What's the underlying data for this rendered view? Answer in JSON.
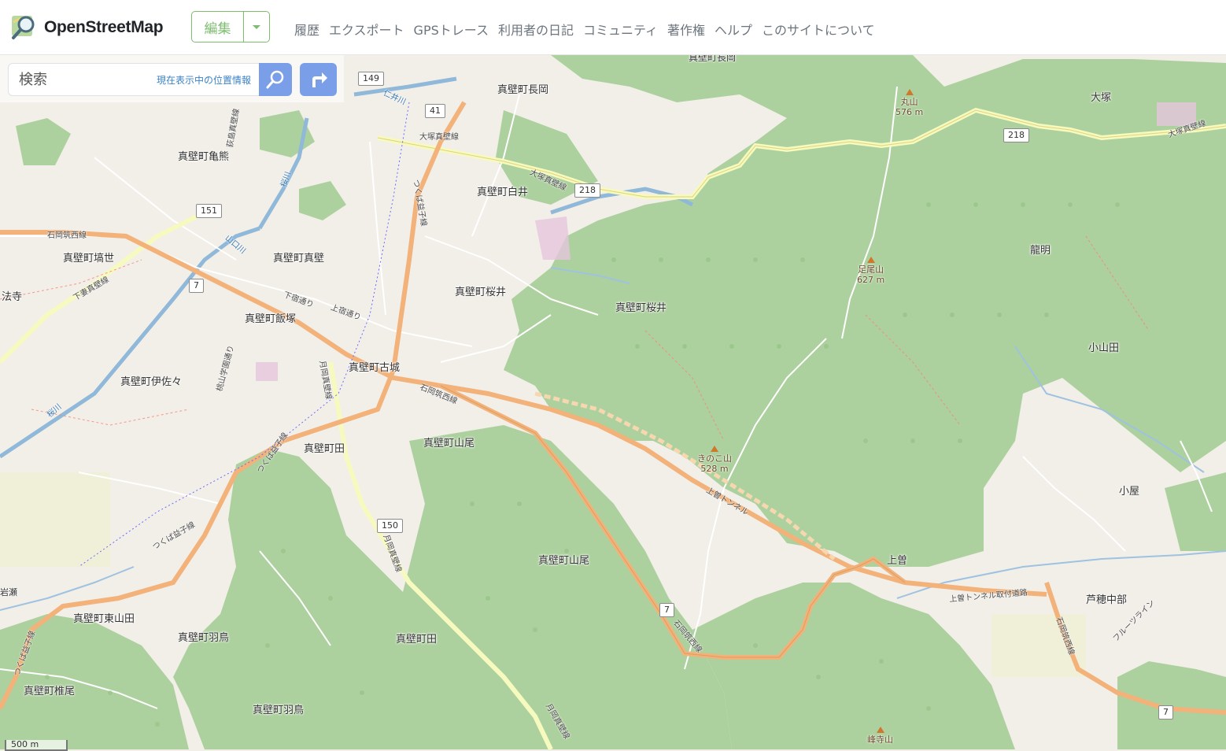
{
  "header": {
    "brand": "OpenStreetMap",
    "edit_label": "編集",
    "nav": [
      "履歴",
      "エクスポート",
      "GPSトレース",
      "利用者の日記",
      "コミュニティ",
      "著作権",
      "ヘルプ",
      "このサイトについて"
    ]
  },
  "search": {
    "placeholder": "検索",
    "where_am_i": "現在表示中の位置情報"
  },
  "map": {
    "places": [
      "真壁町長岡",
      "真壁町長岡",
      "大塚",
      "真壁町亀熊",
      "真壁町白井",
      "真壁町塙世",
      "真壁町真壁",
      "龍明",
      "法寺",
      "真壁町桜井",
      "真壁町桜井",
      "真壁町飯塚",
      "小山田",
      "真壁町古城",
      "真壁町伊佐々",
      "真壁町山尾",
      "真壁町田",
      "小屋",
      "真壁町山尾",
      "上曽",
      "芦穂中部",
      "真壁町東山田",
      "真壁町羽鳥",
      "真壁町田",
      "真壁町椎尾",
      "真壁町羽鳥",
      "岩瀬"
    ],
    "peaks": [
      {
        "name": "丸山",
        "ele": "576 m"
      },
      {
        "name": "足尾山",
        "ele": "627 m"
      },
      {
        "name": "きのこ山",
        "ele": "528 m"
      },
      {
        "name": "峰寺山",
        "ele": ""
      }
    ],
    "shields": [
      "149",
      "41",
      "218",
      "218",
      "151",
      "7",
      "150",
      "7",
      "7"
    ],
    "road_labels": [
      "大塚真壁線",
      "大塚真壁線",
      "大塚真壁線",
      "石岡筑西線",
      "石岡筑西線",
      "石岡筑西線",
      "石岡筑西線",
      "下妻真壁線",
      "つくば益子線",
      "つくば益子線",
      "つくば益子線",
      "つくば益子線",
      "月岡真壁線",
      "月岡真壁線",
      "月岡真壁線",
      "上曽トンネル",
      "上曽トンネル取付道路",
      "下宿通り",
      "上宿通り",
      "桃山学園通り",
      "荻島真壁線",
      "フルーツライン",
      "桜川",
      "桜川",
      "山口川",
      "仁井川"
    ],
    "scale": "500 m"
  }
}
